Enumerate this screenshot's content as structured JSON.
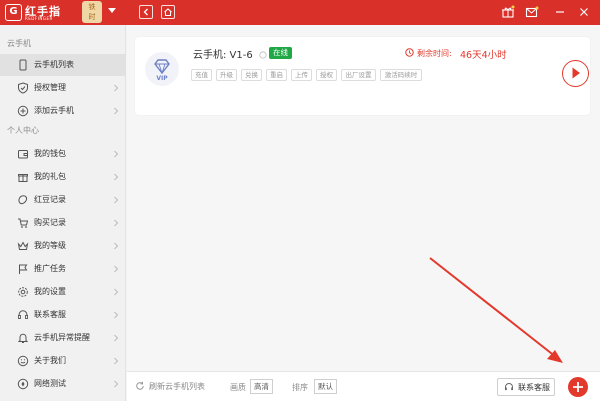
{
  "app": {
    "logo_mark": "G",
    "logo_name": "红手指",
    "logo_sub": "REDFINGER",
    "vip_line1": "铁",
    "vip_line2": "时"
  },
  "sidebar": {
    "section1": "云手机",
    "section1_items": [
      {
        "label": "云手机列表",
        "icon": "phone-icon"
      },
      {
        "label": "授权管理",
        "icon": "shield-icon"
      },
      {
        "label": "添加云手机",
        "icon": "add-circle-icon"
      }
    ],
    "section2": "个人中心",
    "section2_items": [
      {
        "label": "我的钱包",
        "icon": "wallet-icon"
      },
      {
        "label": "我的礼包",
        "icon": "gift-icon"
      },
      {
        "label": "红豆记录",
        "icon": "bean-icon"
      },
      {
        "label": "购买记录",
        "icon": "cart-icon"
      },
      {
        "label": "我的等级",
        "icon": "crown-icon"
      },
      {
        "label": "推广任务",
        "icon": "flag-icon"
      },
      {
        "label": "我的设置",
        "icon": "gear-icon"
      },
      {
        "label": "联系客服",
        "icon": "headset-icon"
      },
      {
        "label": "云手机异常提醒",
        "icon": "bell-icon"
      },
      {
        "label": "关于我们",
        "icon": "smile-icon"
      },
      {
        "label": "网络测试",
        "icon": "network-icon"
      }
    ]
  },
  "device": {
    "name": "云手机: V1-6",
    "status": "在线",
    "remaining_label": "剩余时间:",
    "remaining_value": "46天4小时",
    "actions": [
      "充值",
      "升级",
      "兑换",
      "重启",
      "上传",
      "授权",
      "出厂设置",
      "激活码续时"
    ]
  },
  "bottom": {
    "refresh_label": "刷新云手机列表",
    "quality_label": "画质",
    "quality_value": "高清",
    "sort_label": "排序",
    "sort_value": "默认",
    "contact_label": "联系客服"
  },
  "colors": {
    "brand_red": "#d9302a",
    "accent_red": "#e3392c",
    "online_green": "#21a846"
  }
}
